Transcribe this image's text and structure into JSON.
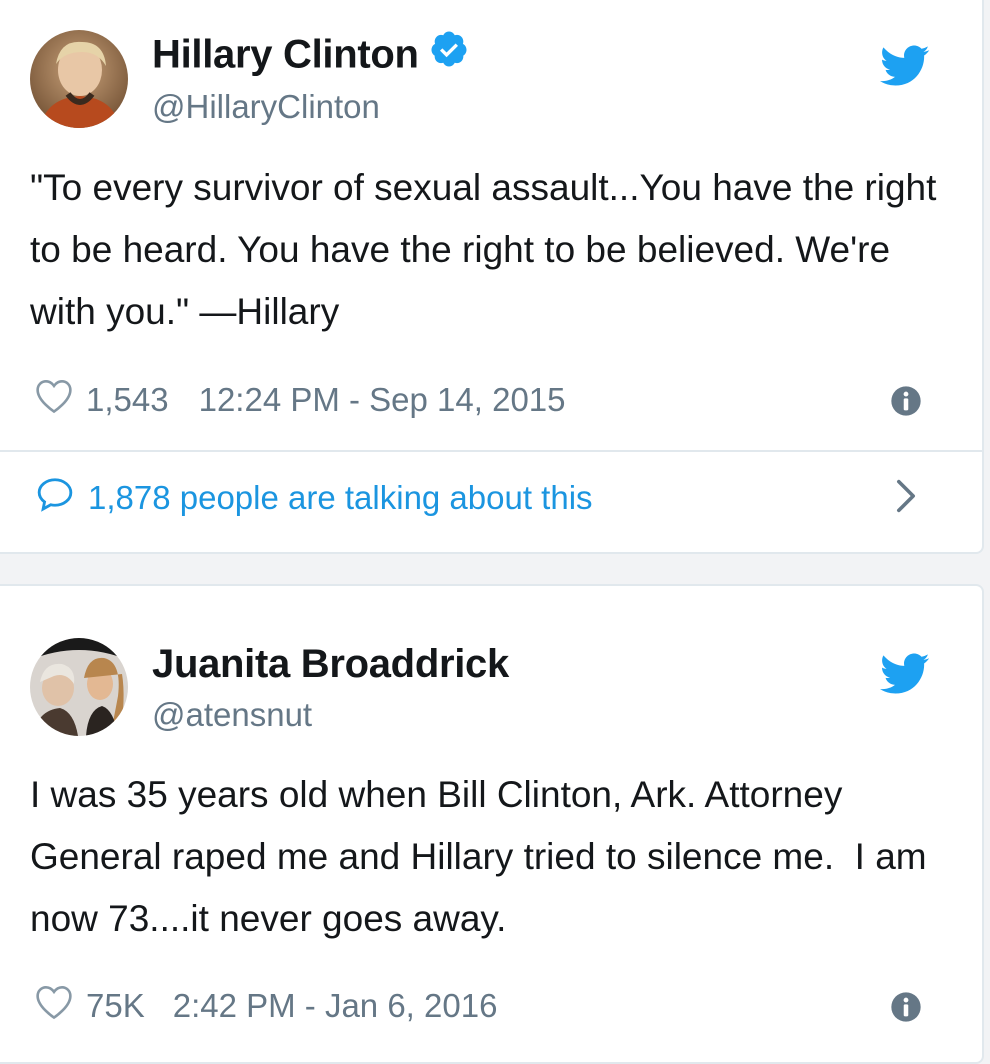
{
  "tweets": [
    {
      "author": "Hillary Clinton",
      "handle": "@HillaryClinton",
      "verified": true,
      "text": "\"To every survivor of sexual assault...You have the right to be heard. You have the right to be believed. We're with you.\" —Hillary",
      "likes": "1,543",
      "timestamp": "12:24 PM - Sep 14, 2015",
      "talking": "1,878 people are talking about this"
    },
    {
      "author": "Juanita Broaddrick",
      "handle": "@atensnut",
      "verified": false,
      "text": "I was 35 years old when Bill Clinton, Ark. Attorney General raped me and Hillary tried to silence me.  I am now 73....it never goes away.",
      "likes": "75K",
      "timestamp": "2:42 PM - Jan 6, 2016"
    }
  ],
  "icons": {
    "brand": "twitter-bird-icon",
    "like": "heart-icon",
    "info": "info-icon",
    "verified": "verified-badge-icon",
    "reply": "speech-bubble-icon",
    "more": "chevron-right-icon"
  },
  "colors": {
    "twitter_blue": "#1da1f2",
    "link_blue": "#1b95e0",
    "secondary_text": "#657786",
    "primary_text": "#14171a",
    "border": "#e1e8ed"
  }
}
